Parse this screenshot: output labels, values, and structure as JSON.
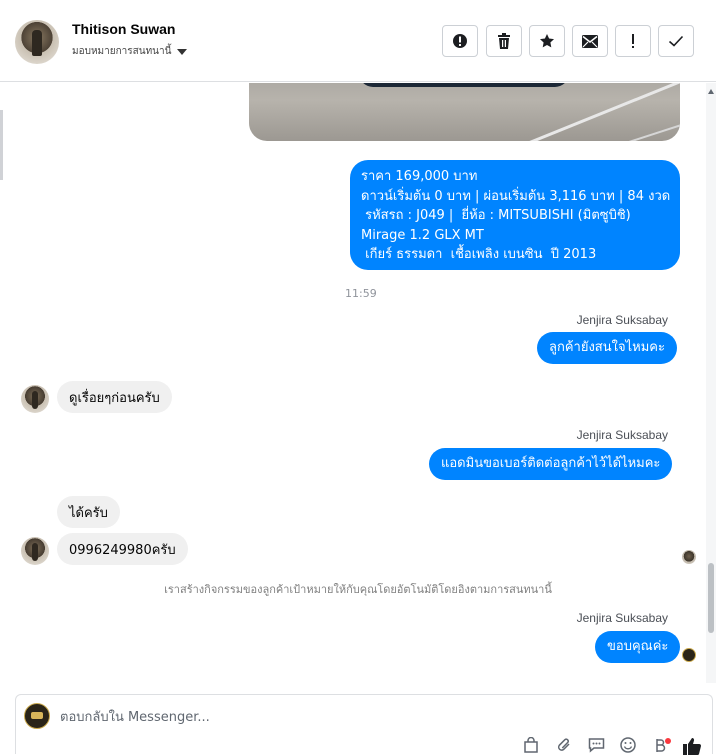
{
  "header": {
    "contact_name": "Thitison Suwan",
    "assign_label": "มอบหมายการสนทนานี้",
    "toolbar": [
      {
        "name": "report-icon",
        "symbol": "!"
      },
      {
        "name": "trash-icon",
        "symbol": ""
      },
      {
        "name": "star-icon",
        "symbol": ""
      },
      {
        "name": "mail-icon",
        "symbol": ""
      },
      {
        "name": "important-icon",
        "symbol": "!"
      },
      {
        "name": "checkmark-icon",
        "symbol": ""
      }
    ]
  },
  "messages": {
    "listing": {
      "line1": "ราคา 169,000 บาท",
      "line2": "ดาวน์เริ่มต้น 0 บาท | ผ่อนเริ่มต้น 3,116 บาท | 84 งวด",
      "line3": " รหัสรถ : J049 |  ยี่ห้อ : MITSUBISHI (มิตซูบิชิ)",
      "line4": "Mirage 1.2 GLX MT",
      "line5": " เกียร์ ธรรมดา  เชื้อเพลิง เบนซิน  ปี 2013"
    },
    "time_1": "11:59",
    "sender_1": "Jenjira Suksabay",
    "out_1": "ลูกค้ายังสนใจไหมคะ",
    "in_1": "ดูเรื่อยๆก่อนครับ",
    "sender_2": "Jenjira Suksabay",
    "out_2": "แอดมินขอเบอร์ติดต่อลูกค้าไว้ได้ไหมคะ",
    "in_2": "ได้ครับ",
    "in_3": "0996249980ครับ",
    "system_note": "เราสร้างกิจกรรมของลูกค้าเป้าหมายให้กับคุณโดยอัตโนมัติโดยอิงตามการสนทนานี้",
    "sender_3": "Jenjira Suksabay",
    "out_3": "ขอบคุณค่ะ"
  },
  "composer": {
    "placeholder": "ตอบกลับใน Messenger...",
    "icons": [
      "bag-icon",
      "attachment-icon",
      "saved-replies-icon",
      "emoji-icon",
      "payment-icon",
      "like-icon"
    ]
  },
  "colors": {
    "outgoing_bubble": "#0084ff",
    "incoming_bubble": "#f0f0f0",
    "like": "#1877f2"
  }
}
